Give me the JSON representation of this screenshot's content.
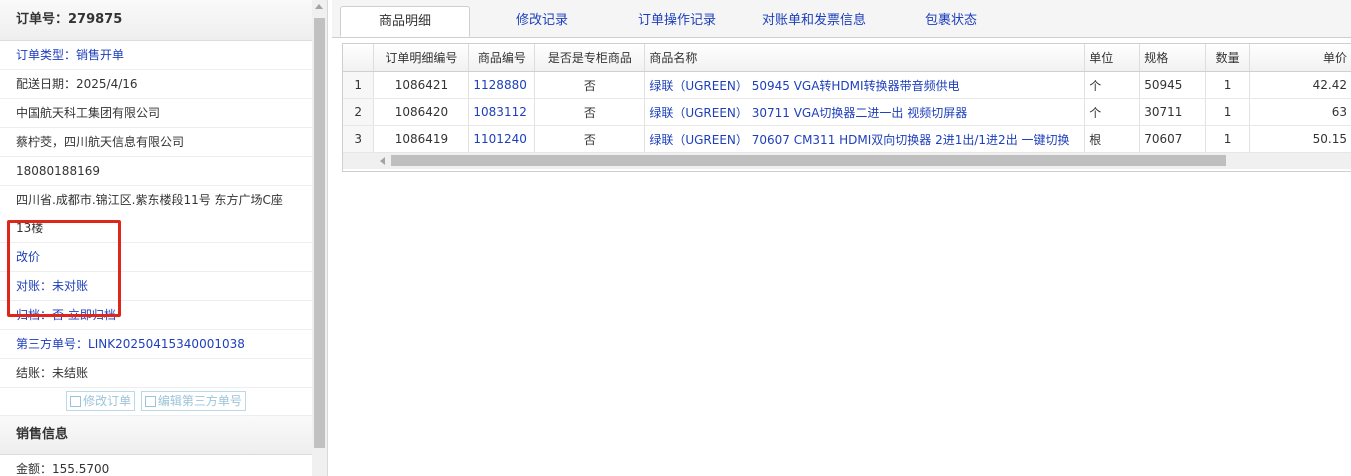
{
  "order": {
    "header": "订单号：279875",
    "type_label": "订单类型：",
    "type_value": "销售开单",
    "delivery_date": "配送日期：2025/4/16",
    "company": "中国航天科工集团有限公司",
    "contact": "蔡柠茭，四川航天信息有限公司",
    "phone": "18080188169",
    "address": "四川省.成都市.锦江区.紫东楼段11号 东方广场C座13楼",
    "change_price": "改价",
    "reconcile_label": "对账：",
    "reconcile_value": "未对账",
    "archive_label": "归档：",
    "archive_value": "否 立即归档",
    "third_party_label": "第三方单号：",
    "third_party_value": "LINK20250415340001038",
    "settle": "结账：未结账",
    "btn_edit_order": "修改订单",
    "btn_edit_third": "编辑第三方单号"
  },
  "sales": {
    "header": "销售信息",
    "amount": "金额：155.5700"
  },
  "tabs": [
    "商品明细",
    "修改记录",
    "订单操作记录",
    "对账单和发票信息",
    "包裹状态"
  ],
  "table": {
    "columns": [
      "",
      "订单明细编号",
      "商品编号",
      "是否是专柜商品",
      "商品名称",
      "单位",
      "规格",
      "数量",
      "单价"
    ],
    "rows": [
      [
        "1",
        "1086421",
        "1128880",
        "否",
        "绿联（UGREEN） 50945 VGA转HDMI转换器带音频供电",
        "个",
        "50945",
        "1",
        "42.42"
      ],
      [
        "2",
        "1086420",
        "1083112",
        "否",
        "绿联（UGREEN） 30711 VGA切换器二进一出 视频切屏器",
        "个",
        "30711",
        "1",
        "63"
      ],
      [
        "3",
        "1086419",
        "1101240",
        "否",
        "绿联（UGREEN） 70607 CM311 HDMI双向切换器 2进1出/1进2出 一键切换",
        "根",
        "70607",
        "1",
        "50.15"
      ]
    ]
  },
  "colors": {
    "link": "#1d3fbb",
    "highlight": "#e0261b"
  }
}
